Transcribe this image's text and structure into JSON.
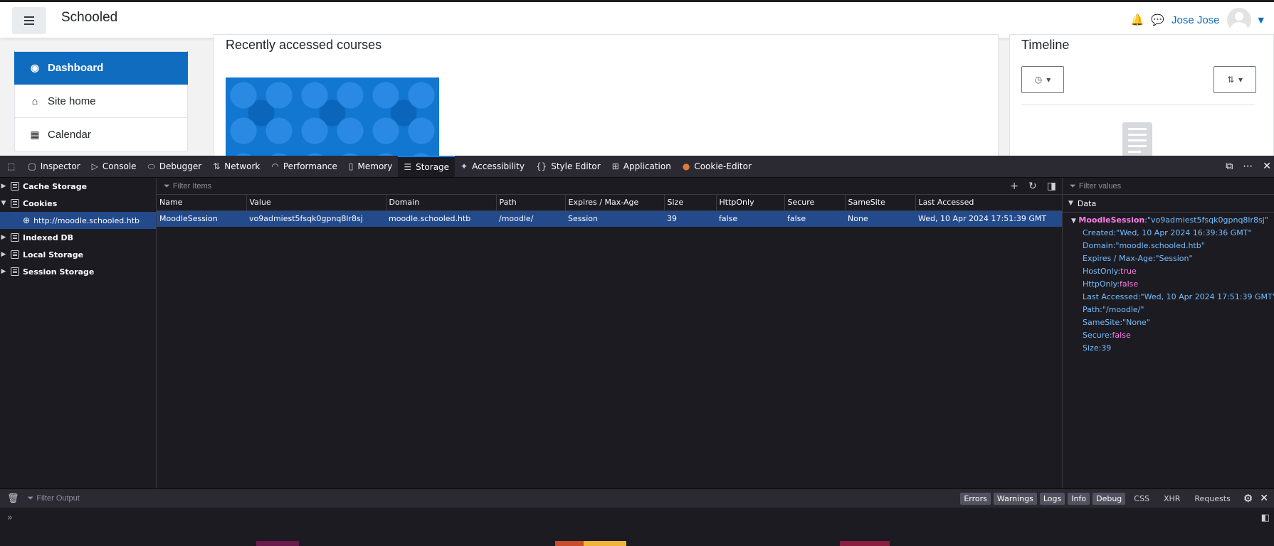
{
  "site": {
    "name": "Schooled",
    "user": "Jose Jose",
    "drawer": [
      "Dashboard",
      "Site home",
      "Calendar"
    ],
    "recent_title": "Recently accessed courses",
    "timeline_title": "Timeline"
  },
  "devtools": {
    "tabs": [
      {
        "label": "Inspector",
        "icon": "inspector-icon"
      },
      {
        "label": "Console",
        "icon": "console-icon"
      },
      {
        "label": "Debugger",
        "icon": "debugger-icon"
      },
      {
        "label": "Network",
        "icon": "network-icon"
      },
      {
        "label": "Performance",
        "icon": "performance-icon"
      },
      {
        "label": "Memory",
        "icon": "memory-icon"
      },
      {
        "label": "Storage",
        "icon": "storage-icon"
      },
      {
        "label": "Accessibility",
        "icon": "accessibility-icon"
      },
      {
        "label": "Style Editor",
        "icon": "style-editor-icon"
      },
      {
        "label": "Application",
        "icon": "application-icon"
      },
      {
        "label": "Cookie-Editor",
        "icon": "cookie-icon"
      }
    ],
    "tree": {
      "cache": "Cache Storage",
      "cookies": "Cookies",
      "host": "http://moodle.schooled.htb",
      "indexed": "Indexed DB",
      "local": "Local Storage",
      "session": "Session Storage"
    },
    "filter_items_placeholder": "Filter Items",
    "filter_values_placeholder": "Filter values",
    "filter_output_placeholder": "Filter Output",
    "columns": [
      "Name",
      "Value",
      "Domain",
      "Path",
      "Expires / Max-Age",
      "Size",
      "HttpOnly",
      "Secure",
      "SameSite",
      "Last Accessed"
    ],
    "rows": [
      [
        "MoodleSession",
        "vo9admiest5fsqk0gpnq8lr8sj",
        "moodle.schooled.htb",
        "/moodle/",
        "Session",
        "39",
        "false",
        "false",
        "None",
        "Wed, 10 Apr 2024 17:51:39 GMT"
      ]
    ],
    "data_heading": "Data",
    "detail": {
      "name": "MoodleSession",
      "value": "\"vo9admiest5fsqk0gpnq8lr8sj\"",
      "props": [
        {
          "k": "Created",
          "v": "\"Wed, 10 Apr 2024 16:39:36 GMT\"",
          "t": "str"
        },
        {
          "k": "Domain",
          "v": "\"moodle.schooled.htb\"",
          "t": "str"
        },
        {
          "k": "Expires / Max-Age",
          "v": "\"Session\"",
          "t": "str"
        },
        {
          "k": "HostOnly",
          "v": "true",
          "t": "bool"
        },
        {
          "k": "HttpOnly",
          "v": "false",
          "t": "bool"
        },
        {
          "k": "Last Accessed",
          "v": "\"Wed, 10 Apr 2024 17:51:39 GMT\"",
          "t": "str"
        },
        {
          "k": "Path",
          "v": "\"/moodle/\"",
          "t": "str"
        },
        {
          "k": "SameSite",
          "v": "\"None\"",
          "t": "str"
        },
        {
          "k": "Secure",
          "v": "false",
          "t": "bool"
        },
        {
          "k": "Size",
          "v": "39",
          "t": "num"
        }
      ]
    },
    "log_levels": [
      "Errors",
      "Warnings",
      "Logs",
      "Info",
      "Debug"
    ],
    "log_extra": [
      "CSS",
      "XHR",
      "Requests"
    ]
  }
}
